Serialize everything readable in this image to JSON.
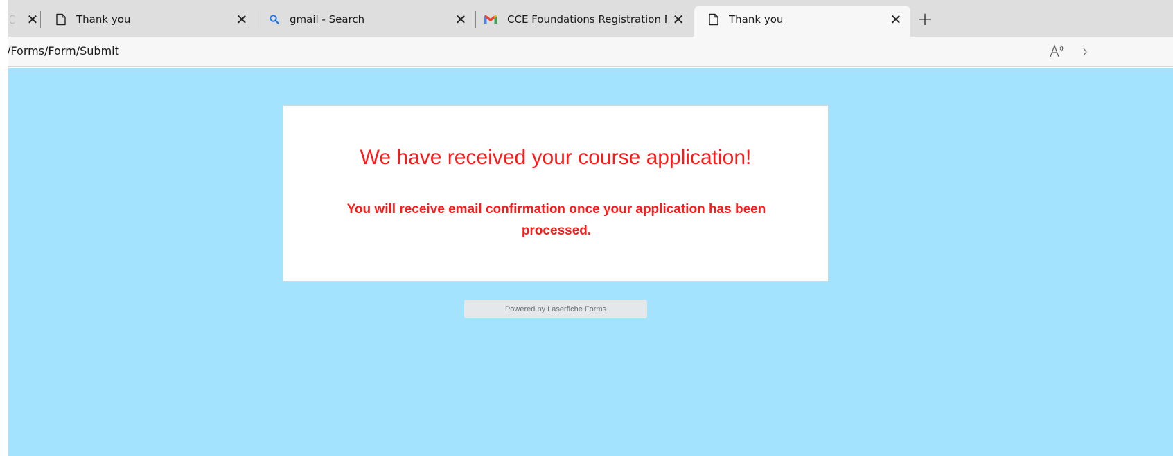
{
  "browser": {
    "tabs": [
      {
        "title": "Thank you",
        "favicon": "page-icon",
        "active": false
      },
      {
        "title": "gmail - Search",
        "favicon": "search-icon",
        "active": false
      },
      {
        "title": "CCE Foundations Registration Fo",
        "favicon": "gmail-icon",
        "active": false
      },
      {
        "title": "Thank you",
        "favicon": "page-icon",
        "active": true
      }
    ],
    "close_glyph": "✕",
    "new_tab_glyph": "+",
    "address": "/Forms/Form/Submit",
    "read_aloud_label": "A⁾"
  },
  "page": {
    "background_color": "#a3e3fd",
    "headline": "We have received your course application!",
    "message": "You will receive email confirmation once your application has been processed.",
    "accent_color": "#ff1a1a",
    "footer": "Powered by Laserfiche Forms"
  }
}
